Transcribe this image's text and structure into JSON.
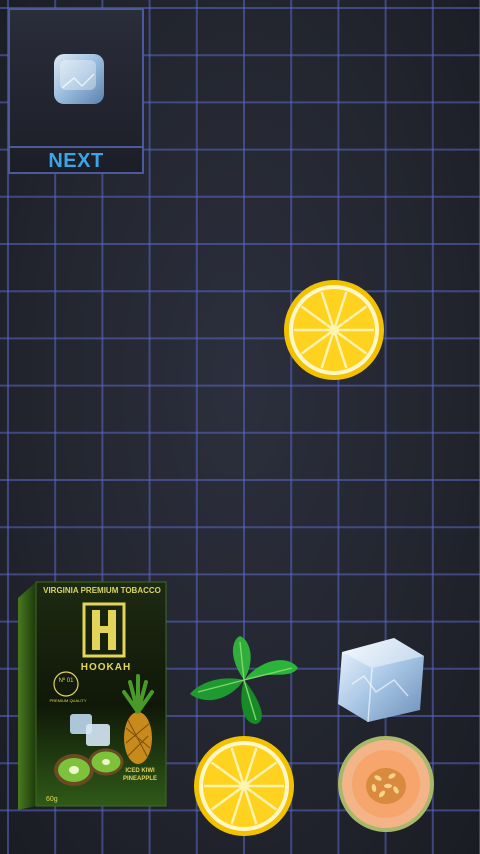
{
  "next_panel": {
    "label": "NEXT",
    "piece": "ice-cube"
  },
  "pieces": [
    {
      "id": "lemon-falling",
      "kind": "lemon-slice"
    },
    {
      "id": "mint",
      "kind": "mint-leaves"
    },
    {
      "id": "ice-right",
      "kind": "ice-cube"
    },
    {
      "id": "lemon-bottom",
      "kind": "lemon-slice"
    },
    {
      "id": "melon",
      "kind": "melon-slice"
    }
  ],
  "product_box": {
    "tagline": "VIRGINIA PREMIUM TOBACCO",
    "brand": "HOOKAH",
    "badge_number": "Nº 01",
    "badge_text": "PREMIUM QUALITY",
    "flavor_line1": "ICED KIWI",
    "flavor_line2": "PINEAPPLE",
    "weight": "60g"
  },
  "colors": {
    "grid_line": "#5a68c8",
    "next_text": "#3aa6e8",
    "box_green": "#2f6b1e",
    "lemon": "#ffd21f"
  }
}
